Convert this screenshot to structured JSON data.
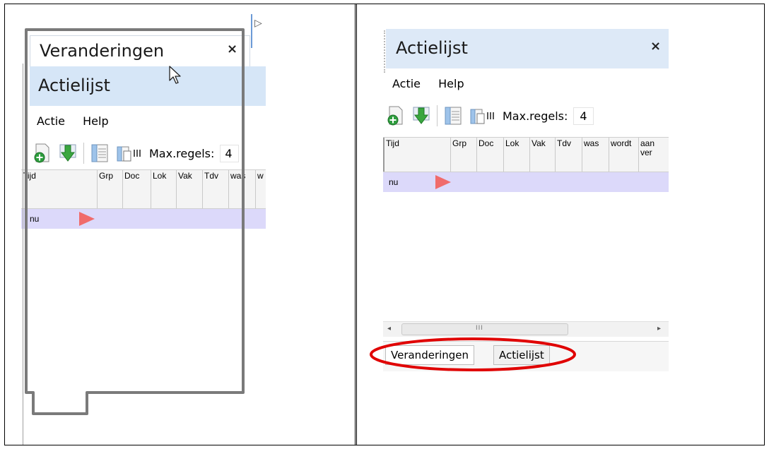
{
  "left": {
    "tab_title": "Veranderingen",
    "panel_title": "Actielijst",
    "close": "×",
    "menu": [
      "Actie",
      "Help"
    ],
    "max_label": "Max.regels:",
    "max_value": "4",
    "columns": [
      "Tijd",
      "Grp",
      "Doc",
      "Lok",
      "Vak",
      "Tdv",
      "was",
      "w"
    ],
    "row_label": "nu"
  },
  "right": {
    "panel_title": "Actielijst",
    "close": "×",
    "menu": [
      "Actie",
      "Help"
    ],
    "max_label": "Max.regels:",
    "max_value": "4",
    "columns": [
      "Tijd",
      "Grp",
      "Doc",
      "Lok",
      "Vak",
      "Tdv",
      "was",
      "wordt",
      "aan ver"
    ],
    "row_label": "nu",
    "scroll_grip": "III",
    "scroll_left": "◂",
    "scroll_right": "▸",
    "tabs": [
      "Veranderingen",
      "Actielijst"
    ]
  },
  "colors": {
    "title_strip": "#d6e6f7",
    "selected_row": "#dcd9fa",
    "arrow": "#f06b6b",
    "annotation": "#e00000",
    "drag_outline": "#7a7a7a"
  },
  "icons": [
    "add-document-icon",
    "download-arrow-icon",
    "form-view-icon",
    "columns-view-icon",
    "cursor-arrow-icon"
  ]
}
